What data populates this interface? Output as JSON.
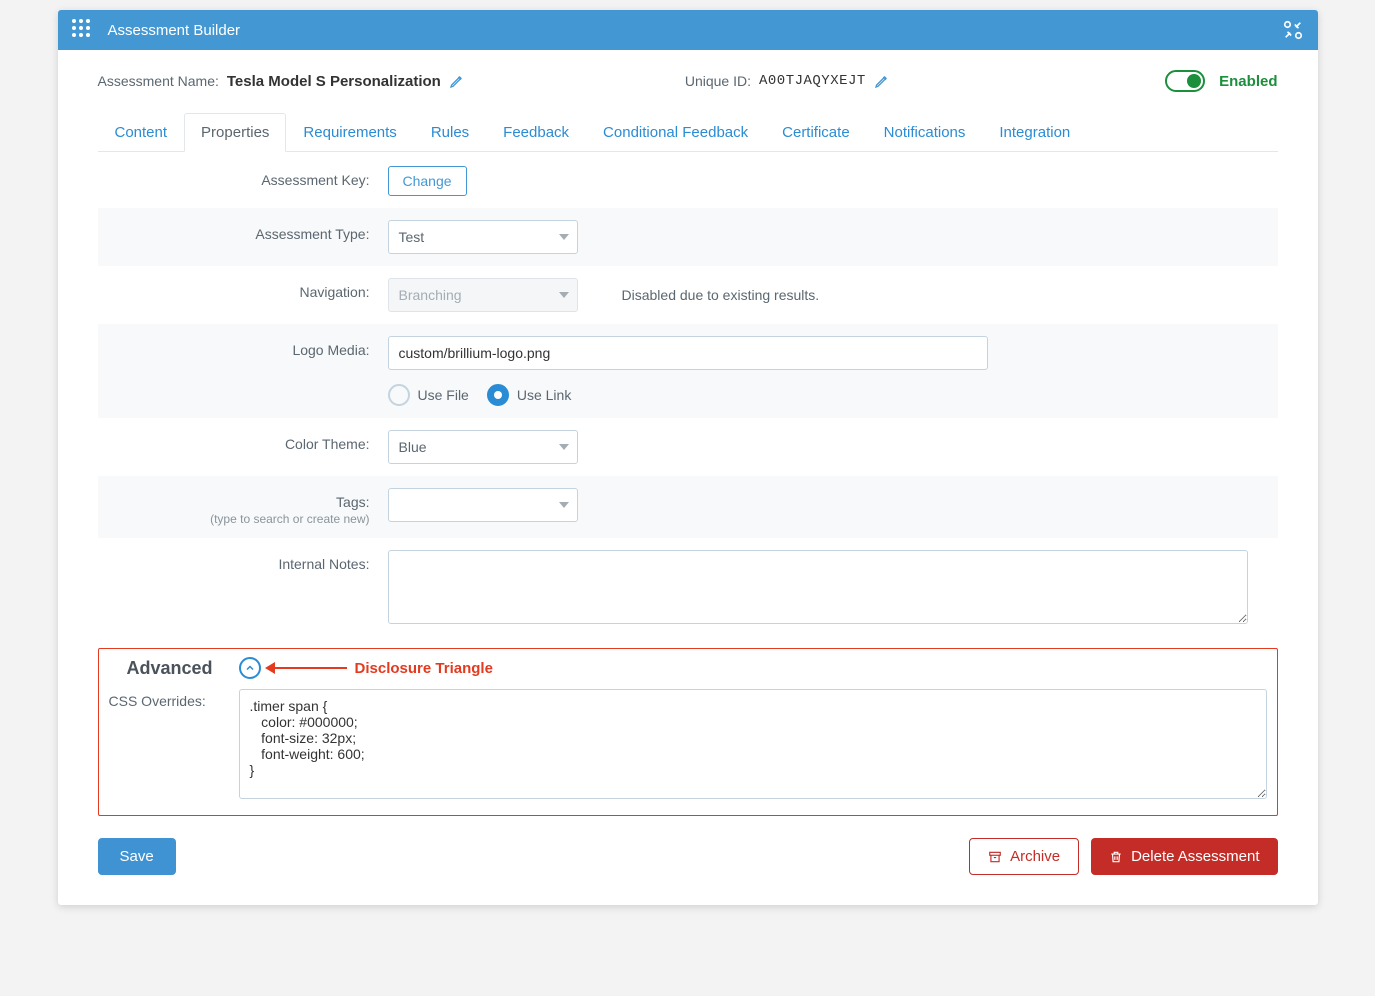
{
  "titlebar": {
    "title": "Assessment Builder"
  },
  "header": {
    "name_label": "Assessment Name:",
    "name_value": "Tesla Model S Personalization",
    "uid_label": "Unique ID:",
    "uid_value": "A00TJAQYXEJT",
    "enabled_label": "Enabled"
  },
  "tabs": [
    {
      "label": "Content"
    },
    {
      "label": "Properties"
    },
    {
      "label": "Requirements"
    },
    {
      "label": "Rules"
    },
    {
      "label": "Feedback"
    },
    {
      "label": "Conditional Feedback"
    },
    {
      "label": "Certificate"
    },
    {
      "label": "Notifications"
    },
    {
      "label": "Integration"
    }
  ],
  "active_tab": "Properties",
  "rows": {
    "assessment_key": {
      "label": "Assessment Key:",
      "button": "Change"
    },
    "assessment_type": {
      "label": "Assessment Type:",
      "value": "Test"
    },
    "navigation": {
      "label": "Navigation:",
      "value": "Branching",
      "note": "Disabled due to existing results."
    },
    "logo_media": {
      "label": "Logo Media:",
      "value": "custom/brillium-logo.png",
      "opt_file": "Use File",
      "opt_link": "Use Link",
      "selected": "link"
    },
    "color_theme": {
      "label": "Color Theme:",
      "value": "Blue"
    },
    "tags": {
      "label": "Tags:",
      "sublabel": "(type to search or create new)",
      "value": ""
    },
    "internal_notes": {
      "label": "Internal Notes:",
      "value": ""
    }
  },
  "advanced": {
    "title": "Advanced",
    "callout": "Disclosure Triangle",
    "css_label": "CSS Overrides:",
    "css_value": ".timer span {\n   color: #000000;\n   font-size: 32px;\n   font-weight: 600;\n}"
  },
  "footer": {
    "save": "Save",
    "archive": "Archive",
    "delete": "Delete Assessment"
  }
}
